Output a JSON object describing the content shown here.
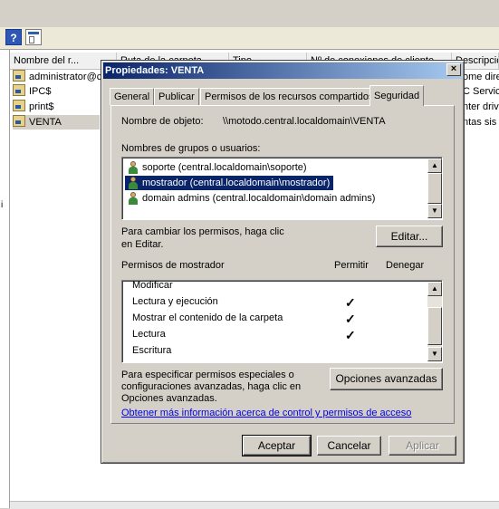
{
  "listview": {
    "columns": [
      "Nombre del r...",
      "Ruta de la carpeta",
      "Tipo",
      "Nº de conexiones de cliente",
      "Descripción"
    ],
    "rows": [
      {
        "name": "administrator@c",
        "desc": "ome dire"
      },
      {
        "name": "IPC$",
        "desc": "C Servic"
      },
      {
        "name": "print$",
        "desc": "nter driv"
      },
      {
        "name": "VENTA",
        "desc": "ntas sis"
      }
    ]
  },
  "dialog": {
    "title": "Propiedades: VENTA",
    "close": "×",
    "tabs": [
      "General",
      "Publicar",
      "Permisos de los recursos compartidos",
      "Seguridad"
    ],
    "active_tab": "Seguridad",
    "object_label": "Nombre de objeto:",
    "object_value": "\\\\motodo.central.localdomain\\VENTA",
    "groups_label": "Nombres de grupos o usuarios:",
    "groups": [
      "soporte (central.localdomain\\soporte)",
      "mostrador (central.localdomain\\mostrador)",
      "domain admins (central.localdomain\\domain admins)"
    ],
    "selected_group_index": 1,
    "change_hint": "Para cambiar los permisos, haga clic en Editar.",
    "change_hint_line1": "Para cambiar los permisos, haga clic",
    "change_hint_line2": "en Editar.",
    "edit_button": "Editar...",
    "perm_header": "Permisos de mostrador",
    "allow_header": "Permitir",
    "deny_header": "Denegar",
    "permissions": [
      {
        "name": "Modificar",
        "allow": false,
        "deny": false
      },
      {
        "name": "Lectura y ejecución",
        "allow": true,
        "deny": false
      },
      {
        "name": "Mostrar el contenido de la carpeta",
        "allow": true,
        "deny": false
      },
      {
        "name": "Lectura",
        "allow": true,
        "deny": false
      },
      {
        "name": "Escritura",
        "allow": false,
        "deny": false
      }
    ],
    "check_glyph": "✓",
    "special_line1": "Para especificar permisos especiales o",
    "special_line2": "configuraciones avanzadas, haga clic en",
    "special_line3": "Opciones avanzadas.",
    "advanced_button": "Opciones avanzadas",
    "learn_link": "Obtener más información acerca de control y permisos de acceso",
    "ok_button": "Aceptar",
    "cancel_button": "Cancelar",
    "apply_button": "Aplicar"
  },
  "toolbar": {
    "help_glyph": "?"
  },
  "leftpane": {
    "char": "i"
  },
  "colors": {
    "title_start": "#0a246a",
    "title_end": "#a6caf0",
    "selection": "#0a246a",
    "link": "#0000ee"
  }
}
